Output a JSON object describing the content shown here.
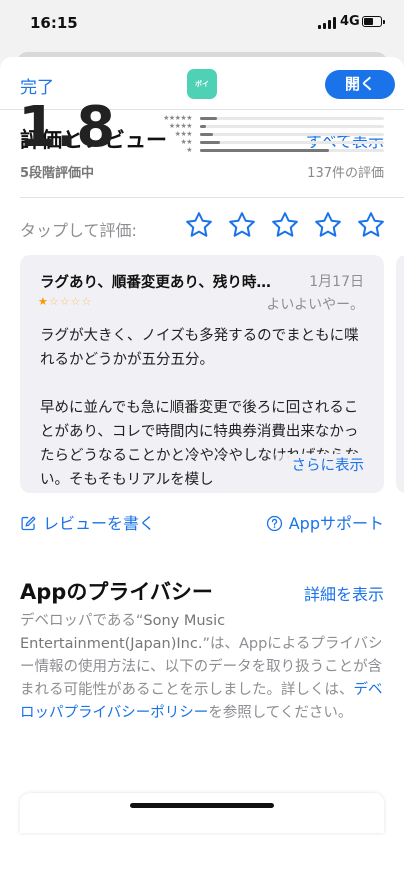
{
  "status_bar": {
    "time": "16:15",
    "network": "4G"
  },
  "header": {
    "done_label": "完了",
    "app_icon_text": "ボイtune",
    "open_label": "開く"
  },
  "ratings": {
    "title": "評価とレビュー",
    "see_all": "すべて表示",
    "average": "1.8",
    "out_of": "5段階評価中",
    "count": "137件の評価",
    "distribution": [
      {
        "stars": "★★★★★",
        "fraction": 0.09
      },
      {
        "stars": "★★★★",
        "fraction": 0.03
      },
      {
        "stars": "★★★",
        "fraction": 0.07
      },
      {
        "stars": "★★",
        "fraction": 0.11
      },
      {
        "stars": "★",
        "fraction": 0.7
      }
    ]
  },
  "tap_to_rate": {
    "label": "タップして評価:"
  },
  "review": {
    "title": "ラグあり、順番変更あり、残り時…",
    "date": "1月17日",
    "rating": 1,
    "stars_on": "★",
    "stars_off": "☆☆☆☆",
    "author": "よいよいやー。",
    "paragraph1": "ラグが大きく、ノイズも多発するのでまともに喋れるかどうかが五分五分。",
    "paragraph2": "早めに並んでも急に順番変更で後ろに回されることがあり、コレで時間内に特典券消費出来なかったらどうなることかと冷や冷やしなければならない。そもそもリアルを模し",
    "more": "さらに表示"
  },
  "actions": {
    "write_review": "レビューを書く",
    "support": "Appサポート"
  },
  "privacy": {
    "title": "Appのプライバシー",
    "details": "詳細を表示",
    "text_before": "デベロッパである“",
    "developer": "Sony Music Entertainment(Japan)Inc.",
    "text_middle": "”は、Appによるプライバシー情報の使用方法に、以下のデータを取り扱うことが含まれる可能性があることを示しました。詳しくは、",
    "policy_link": "デベロッパプライバシーポリシー",
    "text_after": "を参照してください。"
  }
}
